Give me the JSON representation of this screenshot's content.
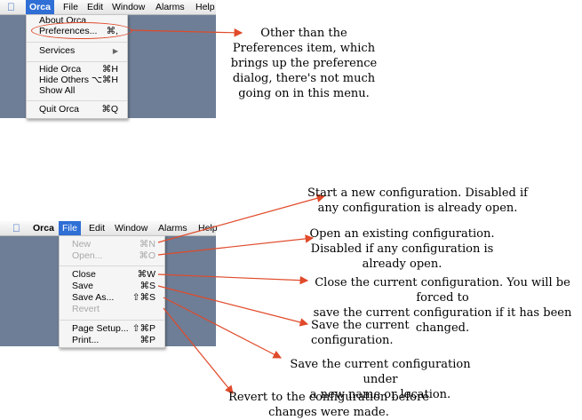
{
  "menu1": {
    "bar": {
      "apple": "",
      "app": "Orca",
      "items": [
        "File",
        "Edit",
        "Window",
        "Alarms",
        "Help"
      ]
    },
    "items": [
      {
        "label": "About Orca",
        "shortcut": ""
      },
      {
        "label": "Preferences...",
        "shortcut": "⌘,"
      },
      {
        "label": "Services",
        "shortcut": "▶"
      },
      {
        "label": "Hide Orca",
        "shortcut": "⌘H"
      },
      {
        "label": "Hide Others",
        "shortcut": "⌥⌘H"
      },
      {
        "label": "Show All",
        "shortcut": ""
      },
      {
        "label": "Quit Orca",
        "shortcut": "⌘Q"
      }
    ]
  },
  "menu2": {
    "bar": {
      "apple": "",
      "app": "Orca",
      "items": [
        "File",
        "Edit",
        "Window",
        "Alarms",
        "Help"
      ]
    },
    "items": [
      {
        "label": "New",
        "shortcut": "⌘N"
      },
      {
        "label": "Open...",
        "shortcut": "⌘O"
      },
      {
        "label": "Close",
        "shortcut": "⌘W"
      },
      {
        "label": "Save",
        "shortcut": "⌘S"
      },
      {
        "label": "Save As...",
        "shortcut": "⇧⌘S"
      },
      {
        "label": "Revert",
        "shortcut": ""
      },
      {
        "label": "Page Setup...",
        "shortcut": "⇧⌘P"
      },
      {
        "label": "Print...",
        "shortcut": "⌘P"
      }
    ]
  },
  "annotations": {
    "preferences": [
      "Other than the",
      "Preferences item, which",
      "brings up the preference",
      "dialog, there's not much",
      "going on in this menu."
    ],
    "new": [
      "Start a new configuration. Disabled if",
      "any configuration is already open."
    ],
    "open": [
      "Open an existing configuration.",
      "Disabled if any configuration is",
      "already open."
    ],
    "close": [
      "Close the current configuration. You will be forced to",
      "save the current configuration if it has been changed."
    ],
    "save": [
      "Save the current configuration."
    ],
    "save_as": [
      "Save the current configuration under",
      "a new name or location."
    ],
    "revert": [
      "Revert to the configuration before",
      "changes were made."
    ]
  },
  "colors": {
    "accent": "#2f6fd6",
    "arrow": "#e04a2a",
    "desktop": "#6e7e96"
  }
}
